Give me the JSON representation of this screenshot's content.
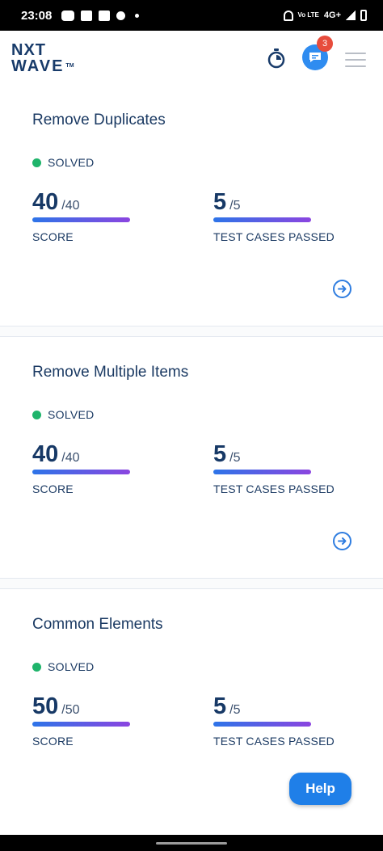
{
  "status_bar": {
    "time": "23:08",
    "network_label": "4G+",
    "volte_label": "Vo LTE"
  },
  "app_bar": {
    "logo_line1": "NXT",
    "logo_line2": "WAVE",
    "logo_tm": "TM",
    "chat_badge_count": "3",
    "icons": [
      "stopwatch-icon",
      "chat-icon",
      "hamburger-menu-icon"
    ]
  },
  "cards": [
    {
      "title": "Remove Duplicates",
      "status": "SOLVED",
      "score": "40",
      "score_total": "/40",
      "score_label": "SCORE",
      "tests": "5",
      "tests_total": "/5",
      "tests_label": "TEST CASES PASSED"
    },
    {
      "title": "Remove Multiple Items",
      "status": "SOLVED",
      "score": "40",
      "score_total": "/40",
      "score_label": "SCORE",
      "tests": "5",
      "tests_total": "/5",
      "tests_label": "TEST CASES PASSED"
    },
    {
      "title": "Common Elements",
      "status": "SOLVED",
      "score": "50",
      "score_total": "/50",
      "score_label": "SCORE",
      "tests": "5",
      "tests_total": "/5",
      "tests_label": "TEST CASES PASSED"
    }
  ],
  "help_button": "Help",
  "colors": {
    "accent": "#1f7fe8",
    "title": "#1b3a63",
    "solved": "#1fb46b",
    "badge": "#e74c3c"
  }
}
